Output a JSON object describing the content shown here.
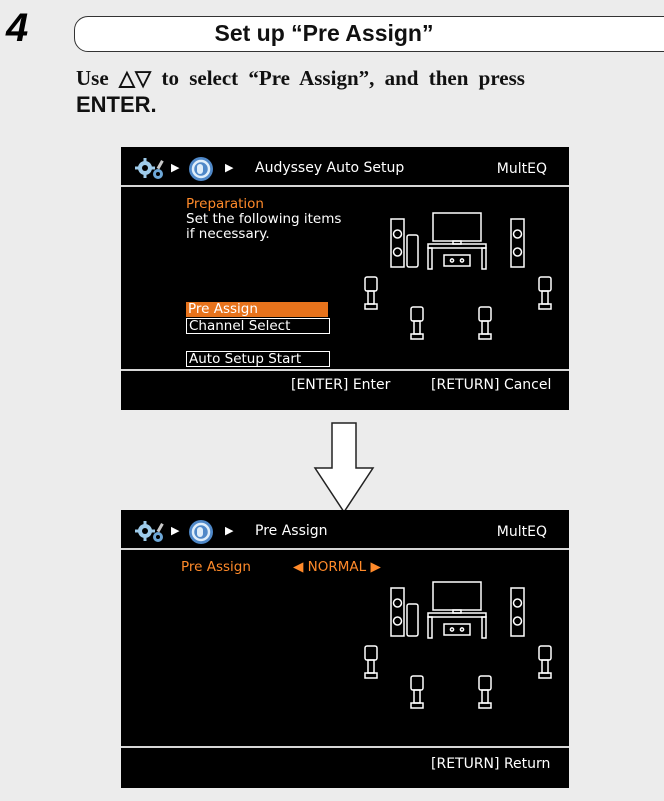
{
  "step": {
    "number": "4",
    "title": "Set up “Pre Assign”",
    "instruction_line1": "Use △▽ to select “Pre Assign”, and then press",
    "instruction_line2": "ENTER."
  },
  "screen1": {
    "breadcrumb": "Audyssey Auto Setup",
    "mode_label": "MultEQ",
    "heading": "Preparation",
    "body_line1": "Set the following items",
    "body_line2": "if necessary.",
    "menu_items": [
      "Pre Assign",
      "Channel Select",
      "Auto Setup Start"
    ],
    "selected_item": "Pre Assign",
    "footer_enter": "[ENTER] Enter",
    "footer_return": "[RETURN] Cancel"
  },
  "screen2": {
    "breadcrumb": "Pre Assign",
    "mode_label": "MultEQ",
    "setting_label": "Pre Assign",
    "setting_value": "◀ NORMAL ▶",
    "footer_return": "[RETURN] Return"
  },
  "icons": {
    "settings": "gear-icon",
    "audyssey": "audyssey-mic-icon",
    "speakers": "speaker-layout-diagram",
    "transition": "down-arrow-icon"
  },
  "colors": {
    "screen_bg": "#000000",
    "highlight": "#e7731c",
    "orange_text": "#ff8a2a"
  }
}
